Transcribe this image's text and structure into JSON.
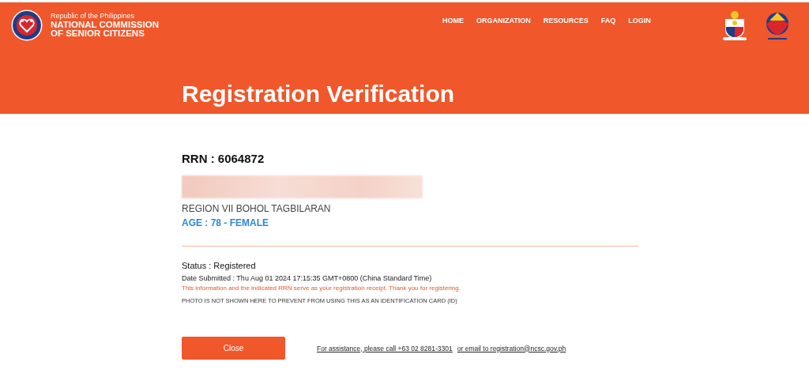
{
  "header": {
    "org_subtitle": "Republic of the Philippines",
    "org_name_line1": "NATIONAL COMMISSION",
    "org_name_line2": "OF SENIOR CITIZENS",
    "nav": [
      {
        "label": "HOME"
      },
      {
        "label": "ORGANIZATION"
      },
      {
        "label": "RESOURCES"
      },
      {
        "label": "FAQ"
      },
      {
        "label": "LOGIN"
      }
    ]
  },
  "page_title": "Registration Verification",
  "record": {
    "rrn": "RRN : 6064872",
    "name_redacted": true,
    "region": "REGION VII BOHOL TAGBILARAN",
    "age_sex": "AGE : 78 - FEMALE",
    "status": "Status : Registered",
    "date_submitted": "Date Submitted : Thu Aug 01 2024 17:15:35 GMT+0800 (China Standard Time)",
    "receipt_note": "This information and the indicated RRN serve as your registration receipt. Thank you for registering.",
    "photo_note": "PHOTO IS NOT SHOWN HERE TO PREVENT FROM USING THIS AS AN IDENTIFICATION CARD (ID)"
  },
  "close_button": "Close",
  "assistance_links": [
    "For assistance, please call +63 02 8281-3301",
    "or email to registration@ncsc.gov.ph"
  ]
}
